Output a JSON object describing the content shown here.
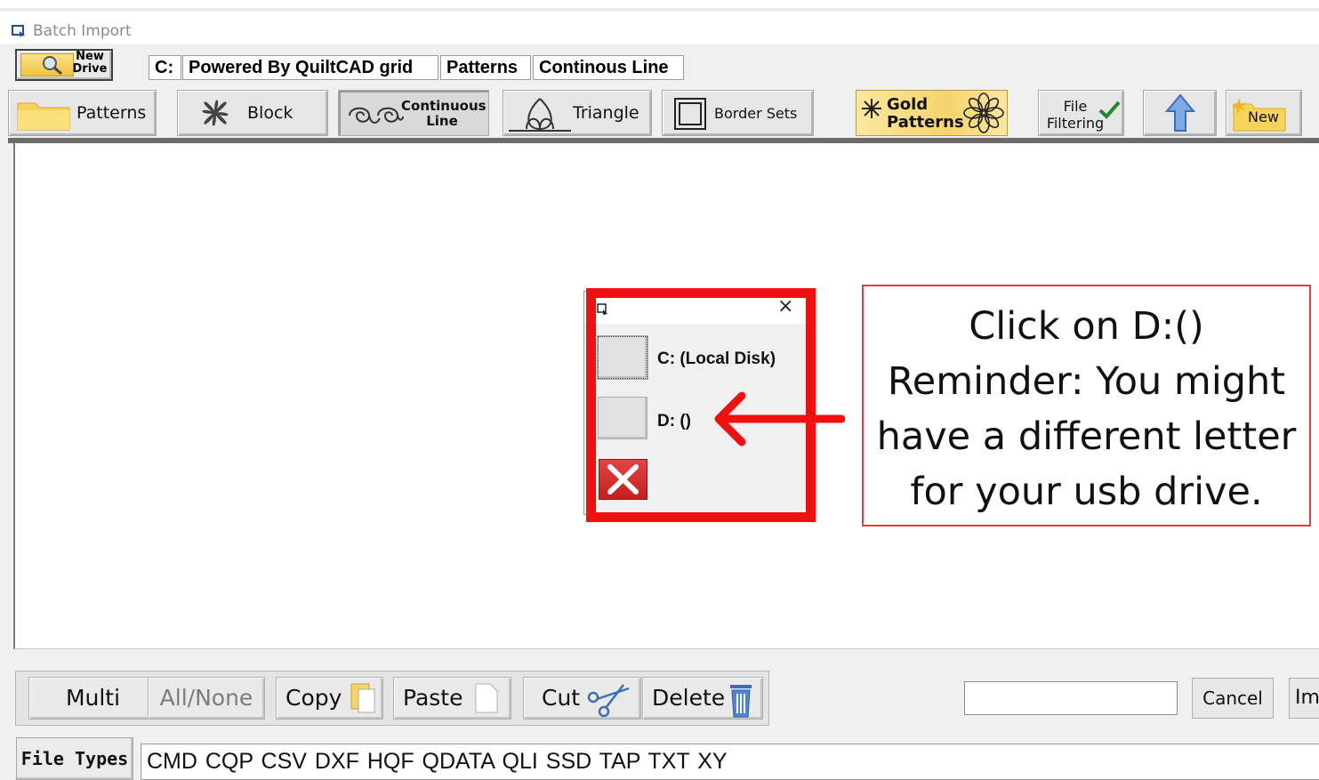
{
  "window": {
    "title": "Batch Import",
    "icon": "window-icon"
  },
  "new_drive_button": {
    "label": "New Drive",
    "icon": "magnifier-icon"
  },
  "path_segments": [
    "C:",
    "Powered By QuiltCAD grid",
    "Patterns",
    "Continous Line"
  ],
  "toolbar": {
    "patterns": "Patterns",
    "block": "Block",
    "continuous_line": "Continuous Line",
    "triangle": "Triangle",
    "border_sets": "Border Sets",
    "gold_patterns": "Gold Patterns",
    "file_filtering": "File Filtering",
    "up_icon": "up-arrow-icon",
    "new": "New"
  },
  "drive_dialog": {
    "close_symbol": "×",
    "drives": [
      "C: (Local Disk)",
      "D: ()"
    ],
    "cancel_icon": "x-icon"
  },
  "annotation": {
    "lines": [
      "Click on D:()",
      "Reminder:  You might",
      "have a different letter",
      "for your usb drive."
    ],
    "color": "#f01010"
  },
  "bottom": {
    "multi": "Multi",
    "all_none": "All/None",
    "copy": "Copy",
    "paste": "Paste",
    "cut": "Cut",
    "delete": "Delete",
    "search_value": "",
    "cancel": "Cancel",
    "import": "Import"
  },
  "file_types": {
    "label": "File Types",
    "value": "CMD  CQP  CSV  DXF  HQF  QDATA  QLI  SSD  TAP  TXT  XY"
  }
}
